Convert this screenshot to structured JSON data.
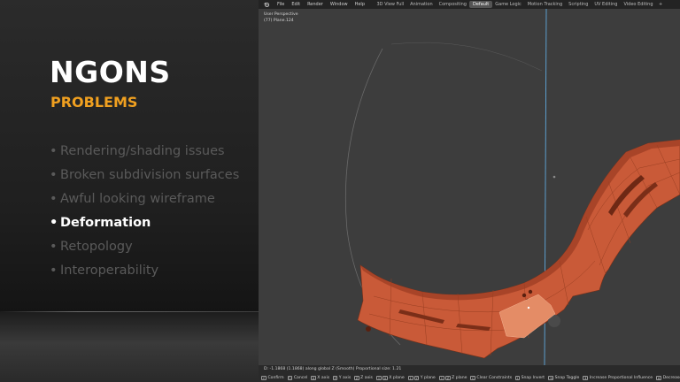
{
  "slide": {
    "title": "NGONS",
    "subtitle": "PROBLEMS",
    "bullets": [
      {
        "text": "Rendering/shading issues",
        "active": false
      },
      {
        "text": "Broken subdivision surfaces",
        "active": false
      },
      {
        "text": "Awful looking wireframe",
        "active": false
      },
      {
        "text": "Deformation",
        "active": true
      },
      {
        "text": "Retopology",
        "active": false
      },
      {
        "text": "Interoperability",
        "active": false
      }
    ],
    "bullet_char": "•",
    "colors": {
      "title": "#ffffff",
      "subtitle": "#f0a020",
      "bullet_dim": "#5a5a5a",
      "bullet_active": "#ffffff"
    }
  },
  "app": {
    "logo_icon": "blender-logo-icon",
    "menus": [
      "File",
      "Edit",
      "Render",
      "Window",
      "Help"
    ],
    "workspace_tabs": [
      {
        "label": "3D View Full",
        "active": false
      },
      {
        "label": "Animation",
        "active": false
      },
      {
        "label": "Compositing",
        "active": false
      },
      {
        "label": "Default",
        "active": true
      },
      {
        "label": "Game Logic",
        "active": false
      },
      {
        "label": "Motion Tracking",
        "active": false
      },
      {
        "label": "Scripting",
        "active": false
      },
      {
        "label": "UV Editing",
        "active": false
      },
      {
        "label": "Video Editing",
        "active": false
      }
    ],
    "add_tab_label": "+",
    "viewport": {
      "view_label": "User Perspective",
      "stats_label": "(77) Plane.124"
    },
    "status": {
      "header": "D: -1.1868 (1.1868) along global Z (Smooth)   Proportional size: 1.21",
      "hints": [
        {
          "keys": [
            "↵"
          ],
          "label": "Confirm"
        },
        {
          "keys": [
            "⎋"
          ],
          "label": "Cancel"
        },
        {
          "keys": [
            "X"
          ],
          "label": "X axis"
        },
        {
          "keys": [
            "Y"
          ],
          "label": "Y axis"
        },
        {
          "keys": [
            "Z"
          ],
          "label": "Z axis"
        },
        {
          "keys": [
            "⇧",
            "X"
          ],
          "label": "X plane"
        },
        {
          "keys": [
            "⇧",
            "Y"
          ],
          "label": "Y plane"
        },
        {
          "keys": [
            "⇧",
            "Z"
          ],
          "label": "Z plane"
        },
        {
          "keys": [
            "C"
          ],
          "label": "Clear Constraints"
        },
        {
          "keys": [
            "I"
          ],
          "label": "Snap Invert"
        },
        {
          "keys": [
            "⇥"
          ],
          "label": "Snap Toggle"
        },
        {
          "keys": [
            "⇞"
          ],
          "label": "Increase Proportional Influence"
        },
        {
          "keys": [
            "⇟"
          ],
          "label": "Decrease"
        }
      ]
    },
    "colors": {
      "mesh": "#c95a38",
      "mesh_dark": "#8e3a22",
      "selected_face": "#e48c66",
      "axis_line": "#5fa8dd"
    }
  }
}
